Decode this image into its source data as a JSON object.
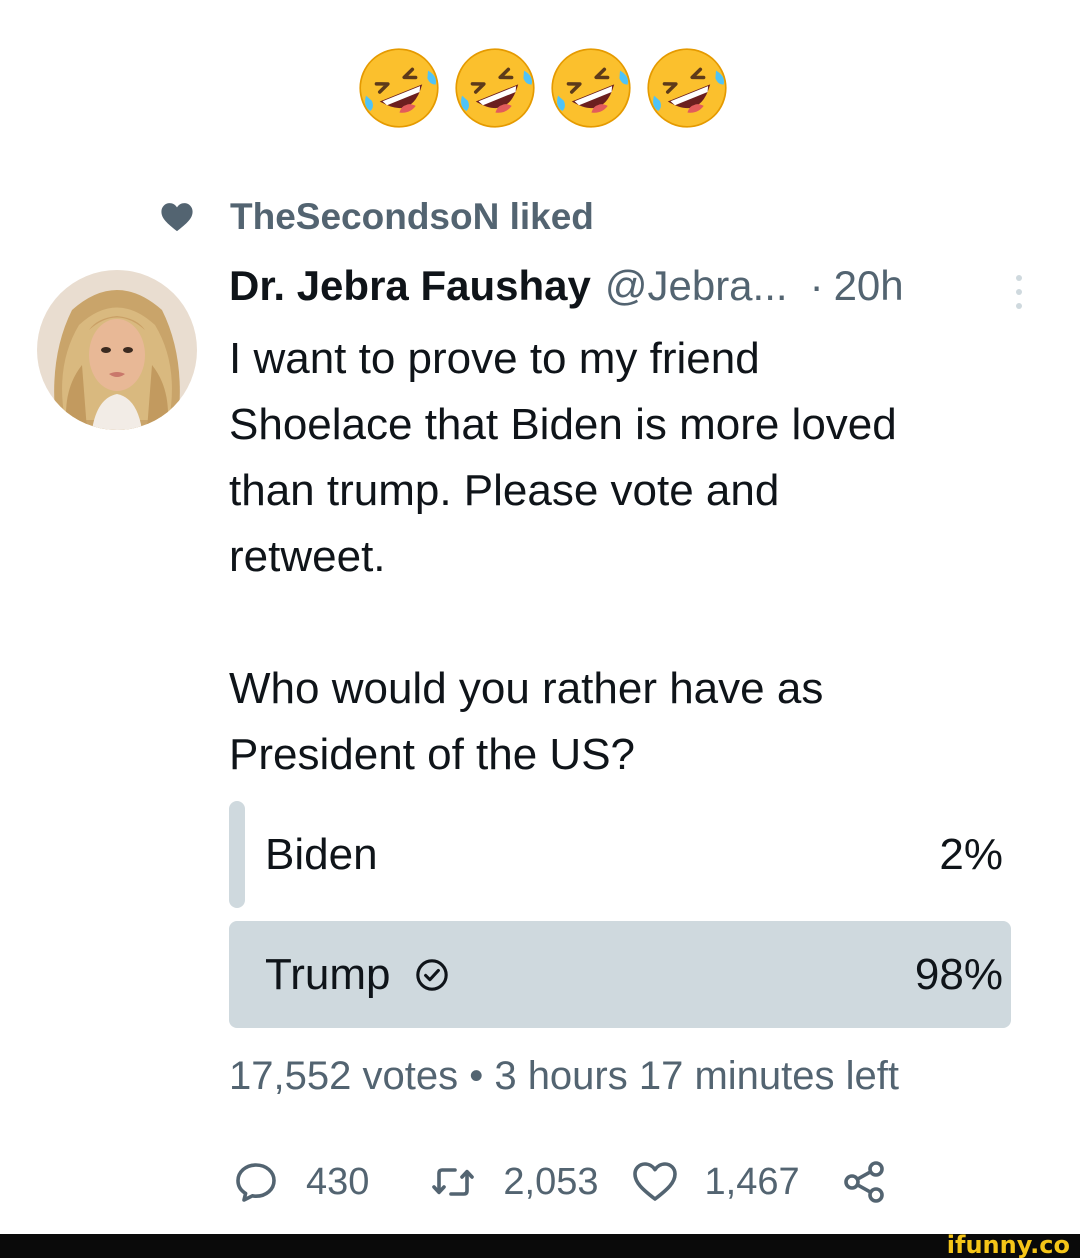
{
  "top_emojis": [
    "rolling-on-floor-laughing",
    "rolling-on-floor-laughing",
    "rolling-on-floor-laughing",
    "rolling-on-floor-laughing"
  ],
  "social_context": {
    "icon": "heart-filled-icon",
    "text": "TheSecondsoN liked"
  },
  "tweet": {
    "author_name": "Dr. Jebra Faushay",
    "author_handle": "@Jebra...",
    "separator": "·",
    "time": "20h",
    "text_lines": [
      "I want to prove to my friend",
      "Shoelace that Biden is more loved",
      "than trump. Please vote and",
      "retweet.",
      "",
      "Who would you rather have as",
      "President of the US?"
    ]
  },
  "poll": {
    "options": [
      {
        "label": "Biden",
        "percent_text": "2%",
        "share": 0.02,
        "selected": false
      },
      {
        "label": "Trump",
        "percent_text": "98%",
        "share": 0.98,
        "selected": true
      }
    ],
    "votes": "17,552 votes",
    "bullet": "•",
    "time_left": "3 hours 17 minutes left"
  },
  "actions": {
    "replies": "430",
    "retweets": "2,053",
    "likes": "1,467"
  },
  "watermark": "ifunny.co",
  "colors": {
    "text_primary": "#0f1419",
    "text_secondary": "#536471",
    "poll_bar": "#cfd9de"
  }
}
